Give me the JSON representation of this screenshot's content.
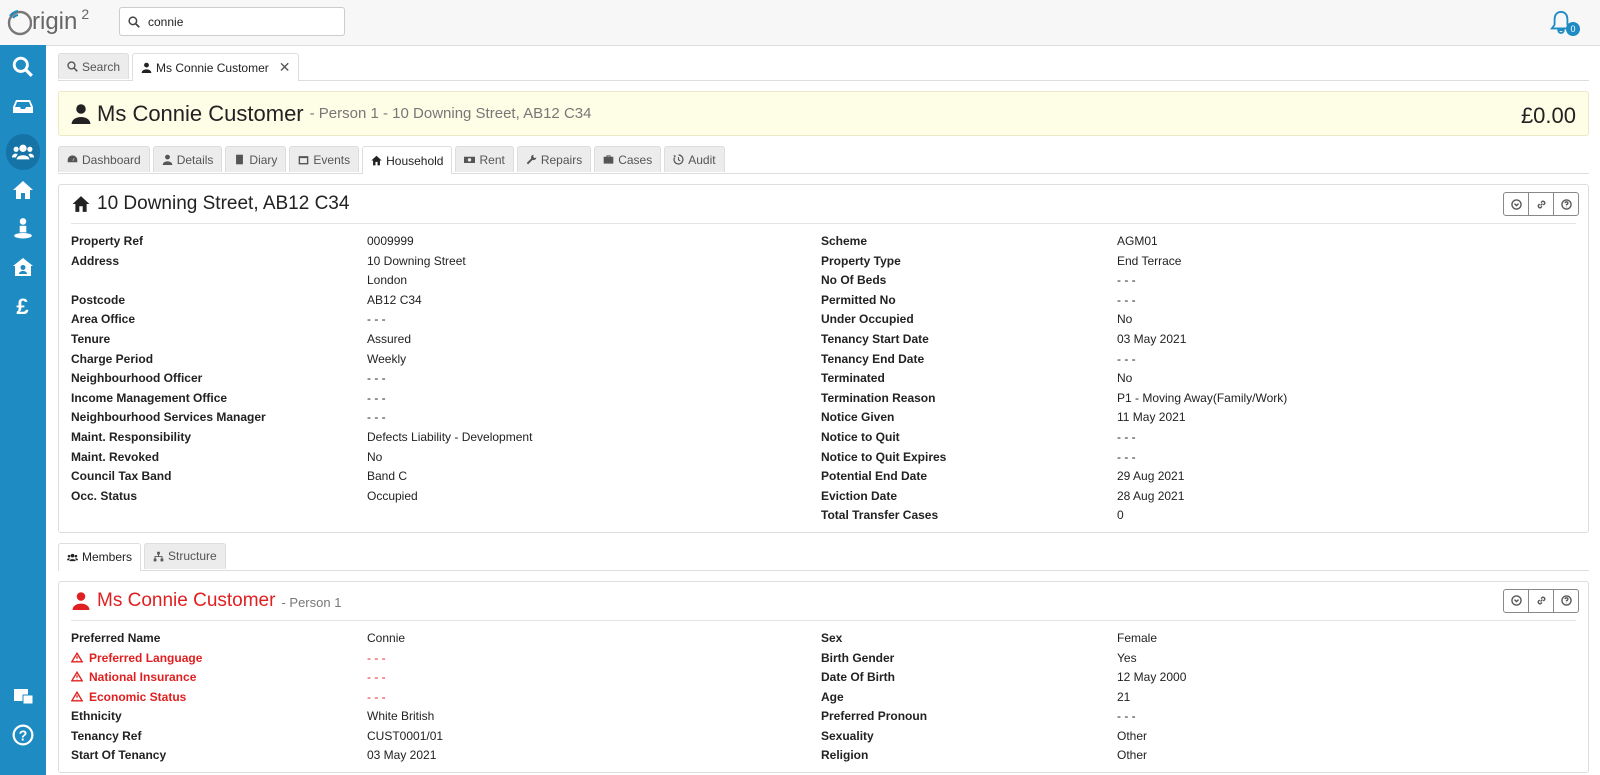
{
  "app": {
    "logo_text": "rigin",
    "logo_sup": "2"
  },
  "search": {
    "value": "connie"
  },
  "notifications": {
    "count": "0"
  },
  "tabs": [
    {
      "label": "Search",
      "icon": "search-icon"
    },
    {
      "label": "Ms Connie Customer",
      "icon": "user-icon",
      "close": "✕"
    }
  ],
  "person": {
    "name": "Ms Connie Customer",
    "subtitle": "- Person 1 - 10 Downing Street, AB12 C34",
    "balance": "£0.00"
  },
  "record_tabs": [
    "Dashboard",
    "Details",
    "Diary",
    "Events",
    "Household",
    "Rent",
    "Repairs",
    "Cases",
    "Audit"
  ],
  "property": {
    "title": "10 Downing Street, AB12 C34",
    "left": [
      {
        "label": "Property Ref",
        "value": "0009999"
      },
      {
        "label": "Address",
        "value": "10 Downing Street",
        "value2": "London"
      },
      {
        "label": "Postcode",
        "value": "AB12 C34"
      },
      {
        "label": "Area Office",
        "value": "- - -"
      },
      {
        "label": "Tenure",
        "value": "Assured"
      },
      {
        "label": "Charge Period",
        "value": "Weekly"
      },
      {
        "label": "Neighbourhood Officer",
        "value": "- - -"
      },
      {
        "label": "Income Management Office",
        "value": "- - -"
      },
      {
        "label": "Neighbourhood Services Manager",
        "value": "- - -"
      },
      {
        "label": "Maint. Responsibility",
        "value": "Defects Liability - Development"
      },
      {
        "label": "Maint. Revoked",
        "value": "No"
      },
      {
        "label": "Council Tax Band",
        "value": "Band C"
      },
      {
        "label": "Occ. Status",
        "value": "Occupied"
      }
    ],
    "right": [
      {
        "label": "Scheme",
        "value": "AGM01"
      },
      {
        "label": "Property Type",
        "value": "End Terrace"
      },
      {
        "label": "No Of Beds",
        "value": "- - -"
      },
      {
        "label": "Permitted No",
        "value": "- - -"
      },
      {
        "label": "Under Occupied",
        "value": "No"
      },
      {
        "label": "Tenancy Start Date",
        "value": "03 May 2021"
      },
      {
        "label": "Tenancy End Date",
        "value": "- - -"
      },
      {
        "label": "Terminated",
        "value": "No"
      },
      {
        "label": "Termination Reason",
        "value": "P1 - Moving Away(Family/Work)"
      },
      {
        "label": "Notice Given",
        "value": "11 May 2021"
      },
      {
        "label": "Notice to Quit",
        "value": "- - -"
      },
      {
        "label": "Notice to Quit Expires",
        "value": "- - -"
      },
      {
        "label": "Potential End Date",
        "value": "29 Aug 2021"
      },
      {
        "label": "Eviction Date",
        "value": "28 Aug 2021"
      },
      {
        "label": "Total Transfer Cases",
        "value": "0"
      }
    ]
  },
  "sub_tabs": [
    "Members",
    "Structure"
  ],
  "member": {
    "name": "Ms Connie Customer",
    "subtitle": "- Person 1",
    "left": [
      {
        "label": "Preferred Name",
        "value": "Connie"
      },
      {
        "label": "Preferred Language",
        "value": "- - -",
        "warn": true
      },
      {
        "label": "National Insurance",
        "value": "- - -",
        "warn": true
      },
      {
        "label": "Economic Status",
        "value": "- - -",
        "warn": true
      },
      {
        "label": "Ethnicity",
        "value": "White British"
      },
      {
        "label": "Tenancy Ref",
        "value": "CUST0001/01"
      },
      {
        "label": "Start Of Tenancy",
        "value": "03 May 2021"
      }
    ],
    "right": [
      {
        "label": "Sex",
        "value": "Female"
      },
      {
        "label": "Birth Gender",
        "value": "Yes"
      },
      {
        "label": "Date Of Birth",
        "value": "12 May 2000"
      },
      {
        "label": "Age",
        "value": "21"
      },
      {
        "label": "Preferred Pronoun",
        "value": "- - -"
      },
      {
        "label": "Sexuality",
        "value": "Other"
      },
      {
        "label": "Religion",
        "value": "Other"
      }
    ]
  }
}
